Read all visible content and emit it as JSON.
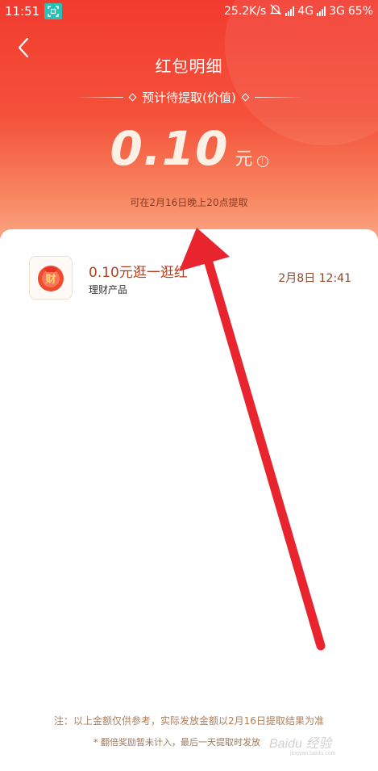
{
  "status_bar": {
    "time": "11:51",
    "network_speed": "25.2K/s",
    "signal1": "4G",
    "signal2": "3G",
    "battery": "65%"
  },
  "header": {
    "title": "红包明细",
    "subtitle": "预计待提取(价值)",
    "amount": "0.10",
    "unit": "元",
    "withdraw_note": "可在2月16日晚上20点提取"
  },
  "records": [
    {
      "icon": "wealth-icon",
      "title": "0.10元逛一逛红",
      "category": "理财产品",
      "date": "2月8日 12:41"
    }
  ],
  "footer": {
    "note": "注：以上金额仅供参考，实际发放金额以2月16日提取结果为准",
    "sub_note": "* 翻倍奖励暂未计入，最后一天提取时发放"
  },
  "colors": {
    "header_red": "#f23b2f",
    "amount_cream": "#fdf0e4",
    "title_brown": "#b3401c",
    "arrow_red": "#e8252f"
  }
}
